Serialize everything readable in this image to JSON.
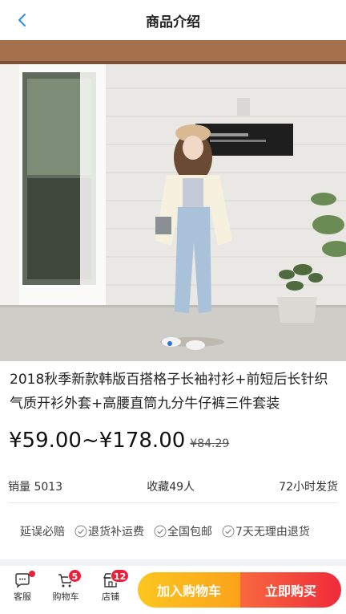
{
  "header": {
    "title": "商品介绍"
  },
  "product": {
    "title": "2018秋季新款韩版百搭格子长袖衬衫+前短后长针织气质开衫外套+高腰直筒九分牛仔裤三件套装",
    "price": "¥59.00~¥178.00",
    "original_price": "¥84.29"
  },
  "stats": {
    "sales": "销量 5013",
    "favorites": "收藏49人",
    "shipping": "72小时发货"
  },
  "guarantees": {
    "label": "延误必赔",
    "items": [
      "退货补运费",
      "全国包邮",
      "7天无理由退货"
    ]
  },
  "bottom_bar": {
    "service_label": "客服",
    "cart_label": "购物车",
    "cart_badge": "5",
    "store_label": "店铺",
    "store_badge": "12",
    "add_to_cart": "加入购物车",
    "buy_now": "立即购买"
  },
  "colors": {
    "accent_red": "#e8203a",
    "cart_button": "#fbb21e",
    "buy_button": "#f04a3c"
  }
}
